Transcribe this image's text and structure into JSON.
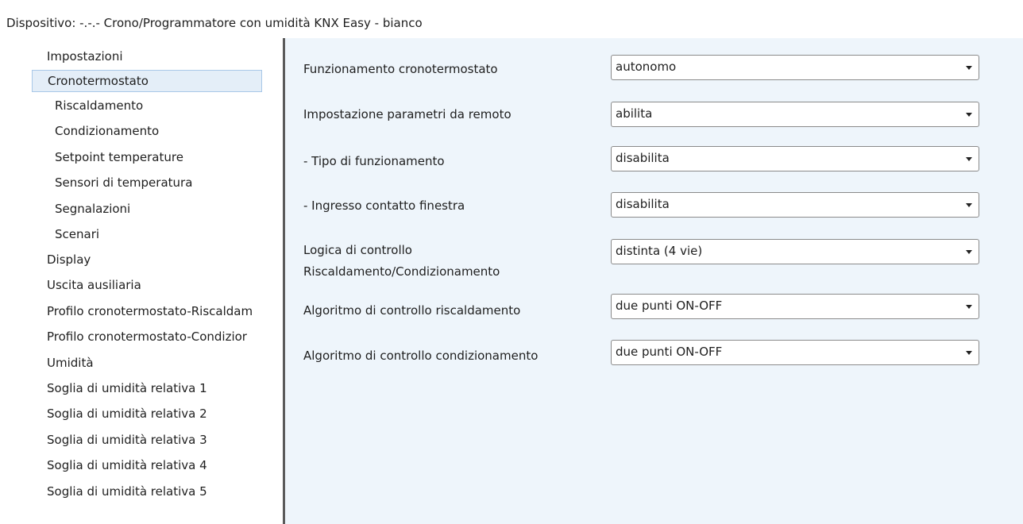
{
  "window": {
    "title": "Dispositivo: -.-.-  Crono/Programmatore con umidità KNX Easy - bianco"
  },
  "sidebar": {
    "items": [
      {
        "label": "Impostazioni"
      },
      {
        "label": "Cronotermostato",
        "selected": true
      },
      {
        "label": "Riscaldamento"
      },
      {
        "label": "Condizionamento"
      },
      {
        "label": "Setpoint temperature"
      },
      {
        "label": "Sensori di temperatura"
      },
      {
        "label": "Segnalazioni"
      },
      {
        "label": "Scenari"
      },
      {
        "label": "Display"
      },
      {
        "label": "Uscita ausiliaria"
      },
      {
        "label": "Profilo cronotermostato-Riscaldam"
      },
      {
        "label": "Profilo cronotermostato-Condizior"
      },
      {
        "label": "Umidità"
      },
      {
        "label": "Soglia di umidità relativa 1"
      },
      {
        "label": "Soglia di umidità relativa 2"
      },
      {
        "label": "Soglia di umidità relativa 3"
      },
      {
        "label": "Soglia di umidità relativa 4"
      },
      {
        "label": "Soglia di umidità relativa 5"
      }
    ]
  },
  "params": [
    {
      "label": "Funzionamento cronotermostato",
      "value": "autonomo"
    },
    {
      "label": "Impostazione parametri da remoto",
      "value": "abilita"
    },
    {
      "label": "- Tipo di funzionamento",
      "value": "disabilita"
    },
    {
      "label": "- Ingresso contatto finestra",
      "value": "disabilita"
    },
    {
      "label_line1": "Logica di controllo",
      "label_line2": "Riscaldamento/Condizionamento",
      "value": "distinta (4 vie)"
    },
    {
      "label": "Algoritmo di controllo riscaldamento",
      "value": "due punti ON-OFF"
    },
    {
      "label": "Algoritmo di controllo condizionamento",
      "value": "due punti ON-OFF"
    }
  ],
  "colors": {
    "main_background": "#eef5fb",
    "selection": "#e4eef8",
    "splitter": "#5a5a5a"
  }
}
